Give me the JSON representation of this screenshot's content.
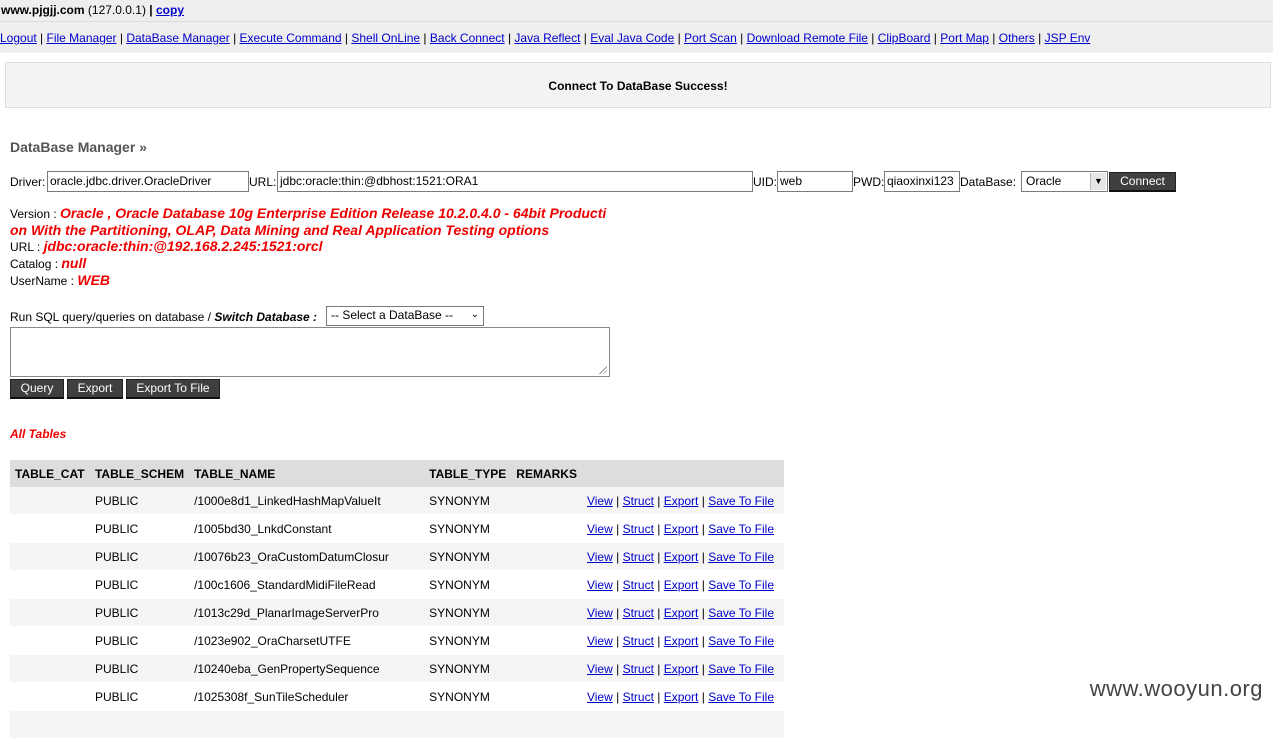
{
  "host": {
    "name": "www.pjgjj.com",
    "ip": "(127.0.0.1)",
    "separator": "|",
    "copy_label": "copy"
  },
  "nav": [
    "Logout",
    "File Manager",
    "DataBase Manager",
    "Execute Command",
    "Shell OnLine",
    "Back Connect",
    "Java Reflect",
    "Eval Java Code",
    "Port Scan",
    "Download Remote File",
    "ClipBoard",
    "Port Map",
    "Others",
    "JSP Env"
  ],
  "message": "Connect To DataBase Success!",
  "section_title": "DataBase Manager »",
  "connect": {
    "driver_label": "Driver:",
    "driver_value": "oracle.jdbc.driver.OracleDriver",
    "url_label": "URL:",
    "url_value": "jdbc:oracle:thin:@dbhost:1521:ORA1",
    "uid_label": "UID:",
    "uid_value": "web",
    "pwd_label": "PWD:",
    "pwd_value": "qiaoxinxi123",
    "db_label": "DataBase:",
    "db_selected": "Oracle",
    "connect_label": "Connect"
  },
  "info": {
    "version_label": "Version : ",
    "version_line1": "Oracle , Oracle Database 10g Enterprise Edition Release 10.2.0.4.0 - 64bit Producti",
    "version_line2": "on With the Partitioning, OLAP, Data Mining and Real Application Testing options",
    "url_label": "URL : ",
    "url_value": "jdbc:oracle:thin:@192.168.2.245:1521:orcl",
    "catalog_label": "Catalog : ",
    "catalog_value": "null",
    "username_label": "UserName : ",
    "username_value": "WEB"
  },
  "sql": {
    "run_label": "Run SQL query/queries on database / ",
    "switch_label": "Switch Database :",
    "select_placeholder": "-- Select a DataBase --",
    "query_label": "Query",
    "export_label": "Export",
    "export_file_label": "Export To File"
  },
  "all_tables_label": "All Tables",
  "table": {
    "headers": [
      "TABLE_CAT",
      "TABLE_SCHEM",
      "TABLE_NAME",
      "TABLE_TYPE",
      "REMARKS"
    ],
    "actions": [
      "View",
      "Struct",
      "Export",
      "Save To File"
    ],
    "rows": [
      {
        "cat": "",
        "schem": "PUBLIC",
        "name": "/1000e8d1_LinkedHashMapValueIt",
        "type": "SYNONYM",
        "remarks": ""
      },
      {
        "cat": "",
        "schem": "PUBLIC",
        "name": "/1005bd30_LnkdConstant",
        "type": "SYNONYM",
        "remarks": ""
      },
      {
        "cat": "",
        "schem": "PUBLIC",
        "name": "/10076b23_OraCustomDatumClosur",
        "type": "SYNONYM",
        "remarks": ""
      },
      {
        "cat": "",
        "schem": "PUBLIC",
        "name": "/100c1606_StandardMidiFileRead",
        "type": "SYNONYM",
        "remarks": ""
      },
      {
        "cat": "",
        "schem": "PUBLIC",
        "name": "/1013c29d_PlanarImageServerPro",
        "type": "SYNONYM",
        "remarks": ""
      },
      {
        "cat": "",
        "schem": "PUBLIC",
        "name": "/1023e902_OraCharsetUTFE",
        "type": "SYNONYM",
        "remarks": ""
      },
      {
        "cat": "",
        "schem": "PUBLIC",
        "name": "/10240eba_GenPropertySequence",
        "type": "SYNONYM",
        "remarks": ""
      },
      {
        "cat": "",
        "schem": "PUBLIC",
        "name": "/1025308f_SunTileScheduler",
        "type": "SYNONYM",
        "remarks": ""
      },
      {
        "cat": "",
        "schem": "",
        "name": "",
        "type": "",
        "remarks": ""
      }
    ]
  },
  "watermark": "www.wooyun.org"
}
